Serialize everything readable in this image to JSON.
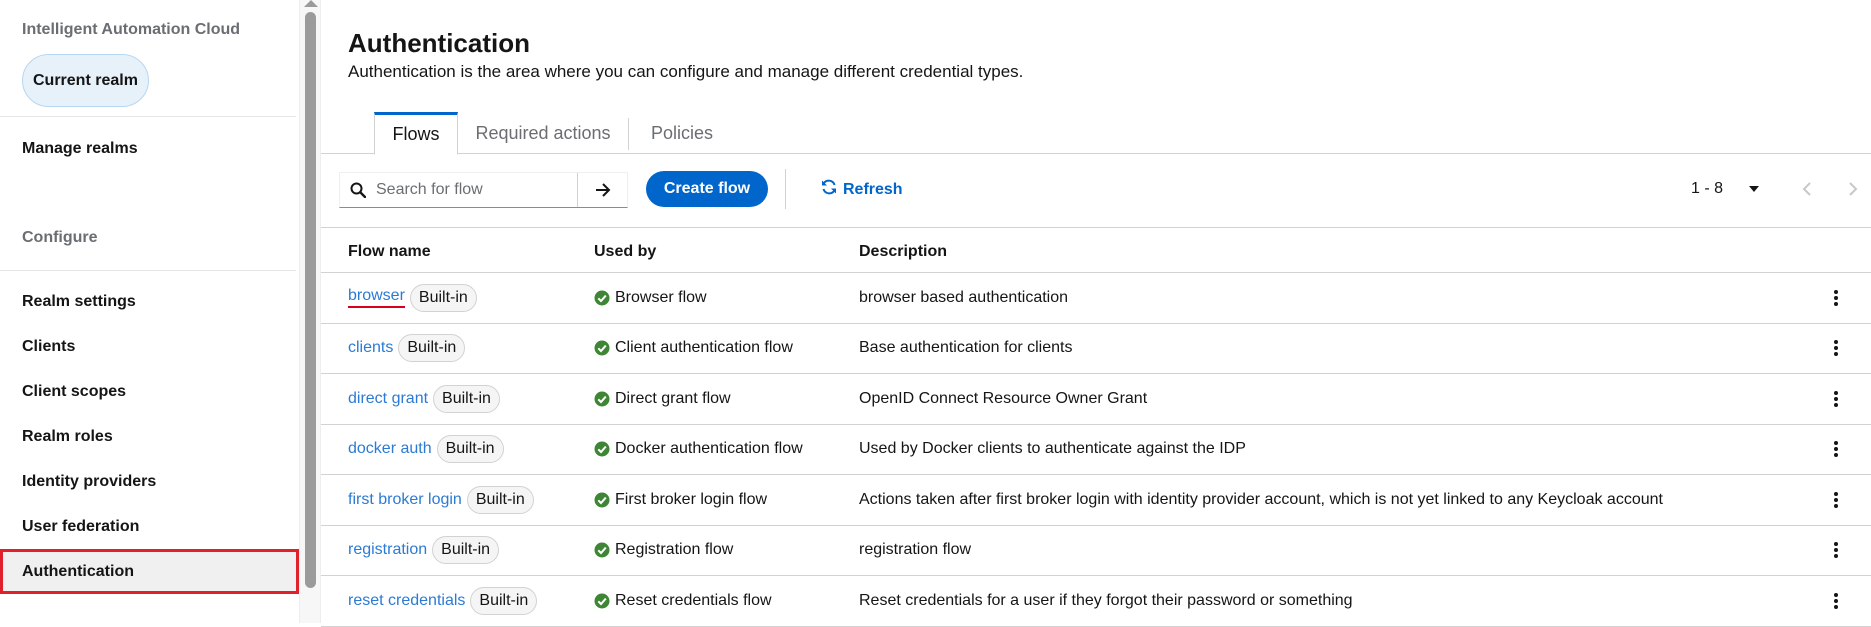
{
  "sidebar": {
    "app_title": "Intelligent Automation Cloud",
    "current_realm": "Current realm",
    "manage_realms": "Manage realms",
    "configure_section": "Configure",
    "items": [
      {
        "label": "Realm settings"
      },
      {
        "label": "Clients"
      },
      {
        "label": "Client scopes"
      },
      {
        "label": "Realm roles"
      },
      {
        "label": "Identity providers"
      },
      {
        "label": "User federation"
      },
      {
        "label": "Authentication",
        "active": true
      }
    ]
  },
  "header": {
    "title": "Authentication",
    "description": "Authentication is the area where you can configure and manage different credential types."
  },
  "tabs": [
    {
      "label": "Flows",
      "active": true
    },
    {
      "label": "Required actions"
    },
    {
      "label": "Policies"
    }
  ],
  "toolbar": {
    "search_placeholder": "Search for flow",
    "create_label": "Create flow",
    "refresh_label": "Refresh",
    "pagination_label": "1 - 8"
  },
  "table": {
    "columns": [
      "Flow name",
      "Used by",
      "Description"
    ],
    "rows": [
      {
        "name": "browser",
        "badge": "Built-in",
        "used_by": "Browser flow",
        "description": "browser based authentication"
      },
      {
        "name": "clients",
        "badge": "Built-in",
        "used_by": "Client authentication flow",
        "description": "Base authentication for clients"
      },
      {
        "name": "direct grant",
        "badge": "Built-in",
        "used_by": "Direct grant flow",
        "description": "OpenID Connect Resource Owner Grant"
      },
      {
        "name": "docker auth",
        "badge": "Built-in",
        "used_by": "Docker authentication flow",
        "description": "Used by Docker clients to authenticate against the IDP"
      },
      {
        "name": "first broker login",
        "badge": "Built-in",
        "used_by": "First broker login flow",
        "description": "Actions taken after first broker login with identity provider account, which is not yet linked to any Keycloak account"
      },
      {
        "name": "registration",
        "badge": "Built-in",
        "used_by": "Registration flow",
        "description": "registration flow"
      },
      {
        "name": "reset credentials",
        "badge": "Built-in",
        "used_by": "Reset credentials flow",
        "description": "Reset credentials for a user if they forgot their password or something"
      }
    ]
  },
  "colors": {
    "accent": "#0066cc",
    "link": "#2b7bd4",
    "success": "#3e8635",
    "highlight": "#e0202a"
  }
}
